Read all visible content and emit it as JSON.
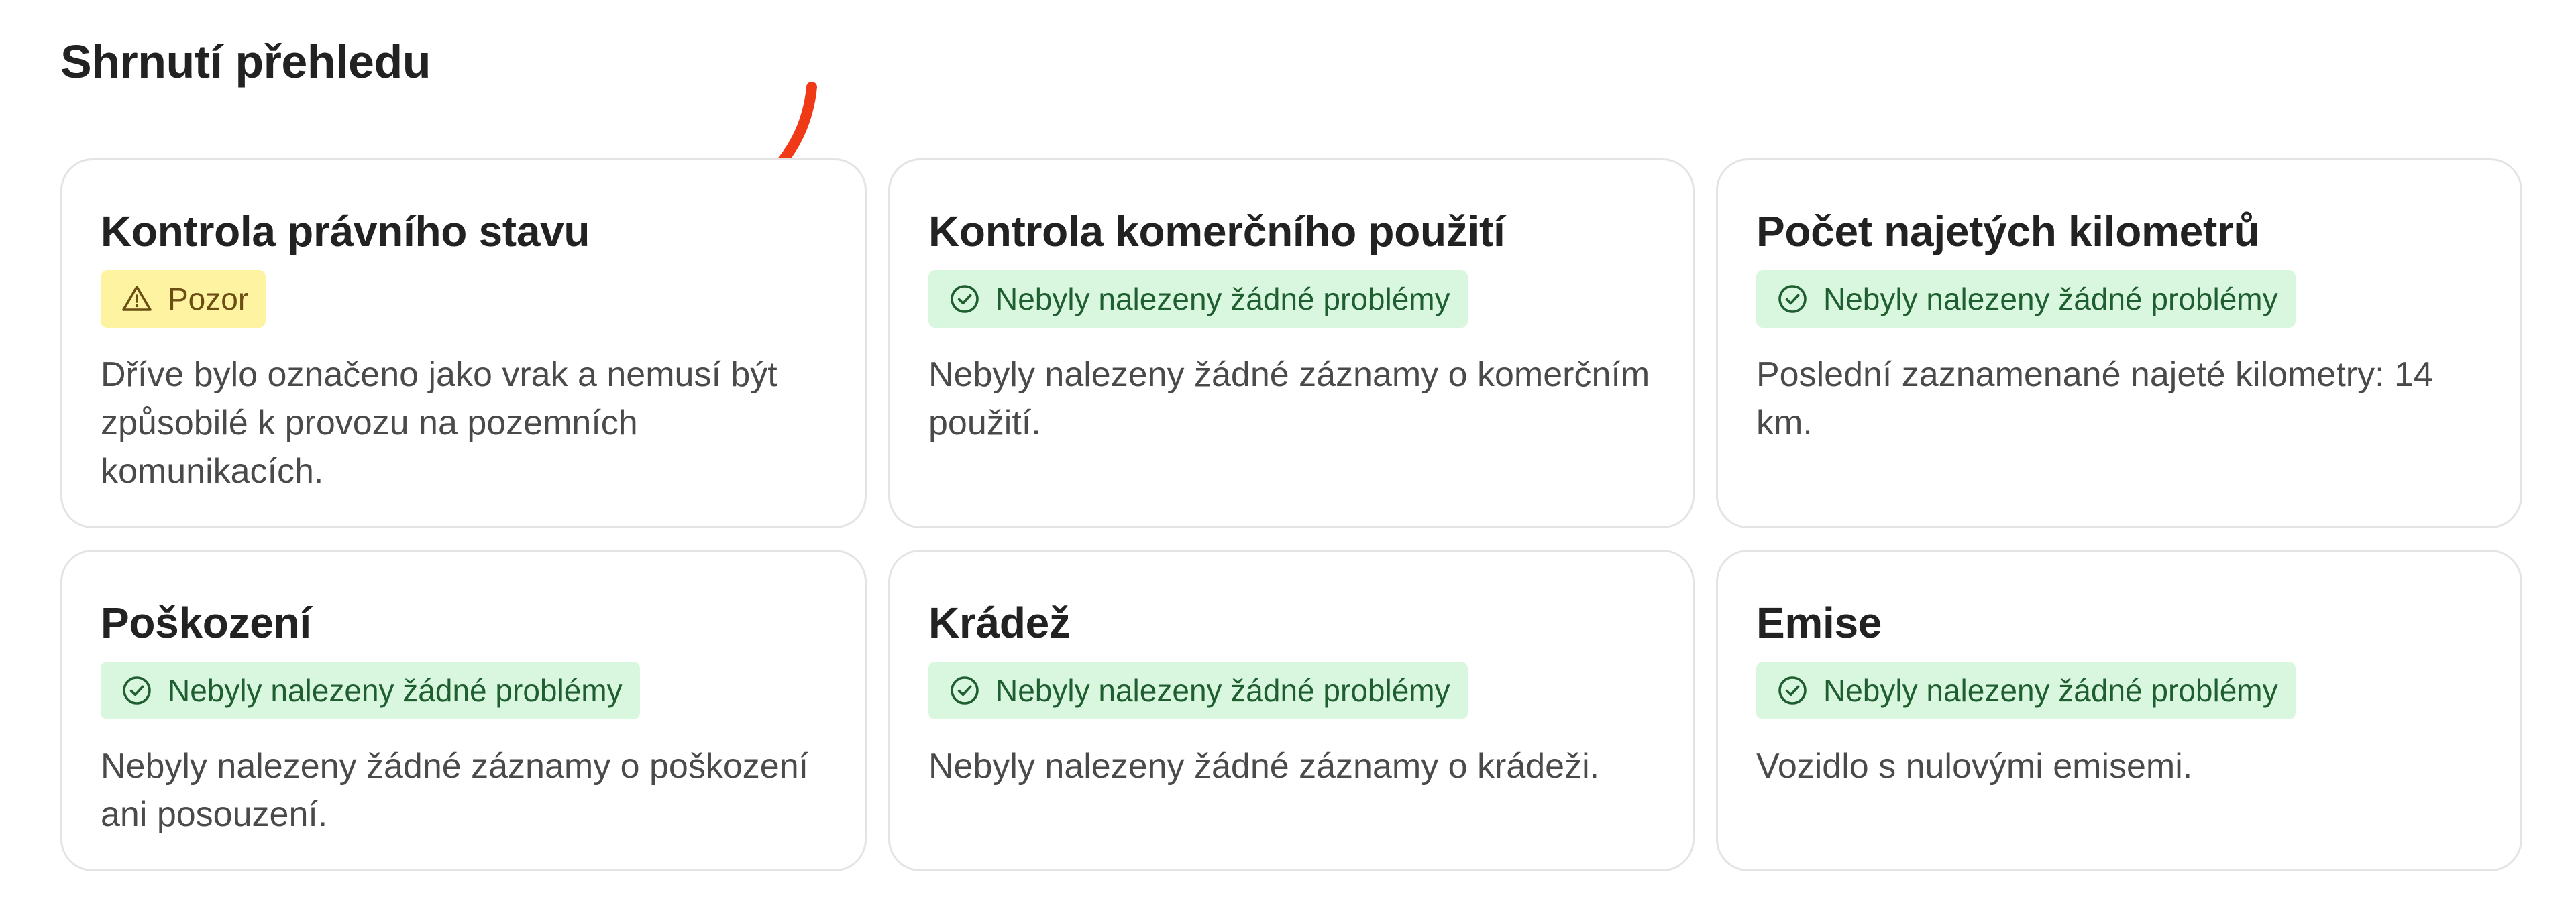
{
  "page": {
    "title": "Shrnutí přehledu"
  },
  "colors": {
    "card_border": "#e4e4e7",
    "badge_ok_bg": "#d9f7df",
    "badge_ok_text": "#1f5e30",
    "badge_warn_bg": "#fdf3a1",
    "badge_warn_text": "#6b4e12",
    "annotation_arrow": "#f03a17"
  },
  "cards": [
    {
      "title": "Kontrola právního stavu",
      "badge": "Pozor",
      "badge_icon": "warning-triangle-icon",
      "status": "warning",
      "description": "Dříve bylo označeno jako vrak a nemusí být způsobilé k provozu na pozemních komunikacích."
    },
    {
      "title": "Kontrola komerčního použití",
      "badge": "Nebyly nalezeny žádné problémy",
      "badge_icon": "check-circle-icon",
      "status": "ok",
      "description": "Nebyly nalezeny žádné záznamy o komerčním použití."
    },
    {
      "title": "Počet najetých kilometrů",
      "badge": "Nebyly nalezeny žádné problémy",
      "badge_icon": "check-circle-icon",
      "status": "ok",
      "description": "Poslední zaznamenané najeté kilometry: 14 km."
    },
    {
      "title": "Poškození",
      "badge": "Nebyly nalezeny žádné problémy",
      "badge_icon": "check-circle-icon",
      "status": "ok",
      "description": "Nebyly nalezeny žádné záznamy o poškození ani posouzení."
    },
    {
      "title": "Krádež",
      "badge": "Nebyly nalezeny žádné problémy",
      "badge_icon": "check-circle-icon",
      "status": "ok",
      "description": "Nebyly nalezeny žádné záznamy o krádeži."
    },
    {
      "title": "Emise",
      "badge": "Nebyly nalezeny žádné problémy",
      "badge_icon": "check-circle-icon",
      "status": "ok",
      "description": "Vozidlo s nulovými emisemi."
    }
  ]
}
